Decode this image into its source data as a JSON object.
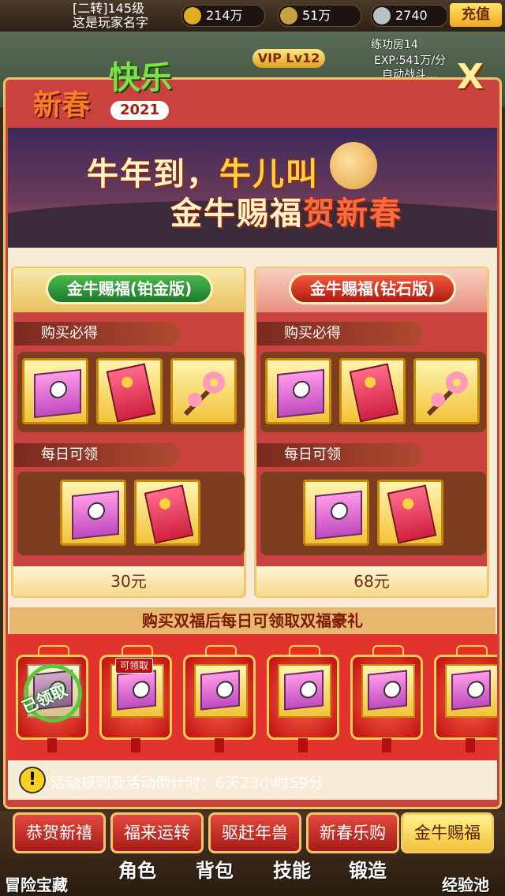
{
  "hud": {
    "rank_line": "[二转]145级",
    "name_line": "这是玩家名字",
    "gold": "214万",
    "coins": "51万",
    "gems": "2740",
    "recharge_label": "充值",
    "room_name": "练功房14",
    "room_exp": "EXP:541万/分",
    "auto_battle": "自动战斗..."
  },
  "event": {
    "title_new": "新春",
    "title_happy": "快乐",
    "year": "2021",
    "vip": "VIP Lv12",
    "close_label": "X",
    "banner_line1_a": "牛年到，",
    "banner_line1_b": "牛儿叫",
    "banner_line2_a": "金牛赐福",
    "banner_line2_b": "贺新春"
  },
  "cards": [
    {
      "name": "金牛赐福(铂金版)",
      "buy_label": "购买必得",
      "daily_label": "每日可领",
      "price": "30元",
      "buy_items": [
        "gift-box-icon",
        "red-envelope-icon",
        "plum-blossom-icon"
      ],
      "daily_items": [
        "gift-box-icon",
        "red-envelope-icon"
      ]
    },
    {
      "name": "金牛赐福(钻石版)",
      "buy_label": "购买必得",
      "daily_label": "每日可领",
      "price": "68元",
      "buy_items": [
        "gift-box-icon",
        "red-envelope-icon",
        "plum-blossom-icon"
      ],
      "daily_items": [
        "gift-box-icon",
        "red-envelope-icon"
      ]
    }
  ],
  "bonus": {
    "header": "购买双福后每日可领取双福豪礼",
    "claimed_label": "已领取",
    "claimable_label": "可领取"
  },
  "tip": {
    "text": "活动规则及活动倒计时：6天23小时59分"
  },
  "tabs": [
    "恭贺新禧",
    "福来运转",
    "驱赶年兽",
    "新春乐购",
    "金牛赐福"
  ],
  "nav": [
    "冒险宝藏",
    "角色",
    "背包",
    "技能",
    "锻造",
    "经验池"
  ],
  "colors": {
    "panel_red": "#c9423f",
    "gold_border": "#f2c56e",
    "cream": "#f8ecd6"
  }
}
